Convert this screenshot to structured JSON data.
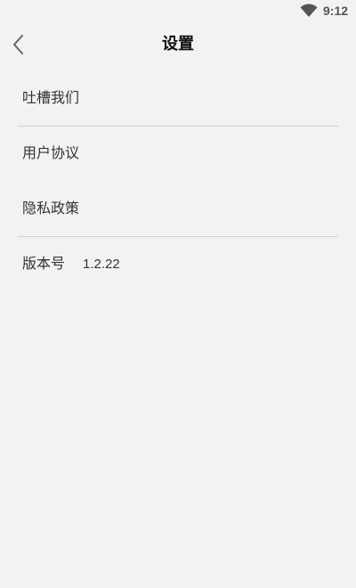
{
  "status_bar": {
    "time": "9:12",
    "wifi_icon": "wifi-icon"
  },
  "nav": {
    "back_icon": "chevron-left-icon",
    "title": "设置"
  },
  "settings": {
    "items": [
      {
        "label": "吐槽我们"
      },
      {
        "label": "用户协议"
      },
      {
        "label": "隐私政策"
      },
      {
        "label": "版本号",
        "value": "1.2.22"
      }
    ]
  },
  "colors": {
    "background": "#f2f2f2",
    "divider": "#d0d0d0",
    "text": "#333333",
    "title": "#111111"
  }
}
